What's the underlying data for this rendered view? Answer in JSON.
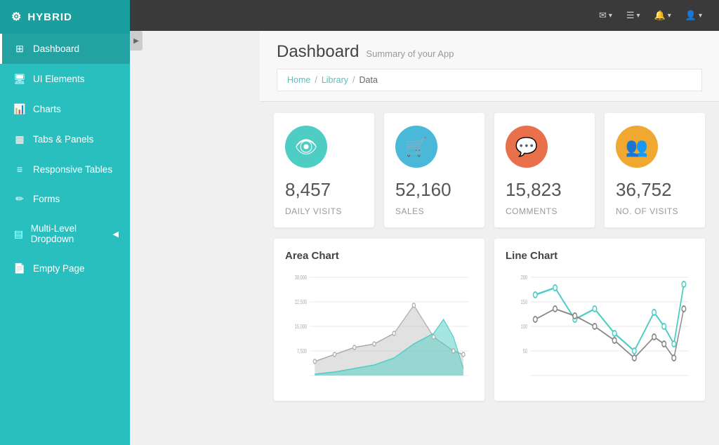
{
  "app": {
    "name": "HYBRID"
  },
  "topbar": {
    "mail_label": "✉",
    "menu_label": "☰",
    "bell_label": "🔔",
    "user_label": "👤"
  },
  "sidebar": {
    "items": [
      {
        "id": "dashboard",
        "label": "Dashboard",
        "icon": "⊞",
        "active": true
      },
      {
        "id": "ui-elements",
        "label": "UI Elements",
        "icon": "🖥"
      },
      {
        "id": "charts",
        "label": "Charts",
        "icon": "📊"
      },
      {
        "id": "tabs-panels",
        "label": "Tabs & Panels",
        "icon": "▦"
      },
      {
        "id": "responsive-tables",
        "label": "Responsive Tables",
        "icon": "≡"
      },
      {
        "id": "forms",
        "label": "Forms",
        "icon": "✏"
      },
      {
        "id": "multi-level-dropdown",
        "label": "Multi-Level Dropdown",
        "icon": "▤",
        "has_arrow": true
      },
      {
        "id": "empty-page",
        "label": "Empty Page",
        "icon": "📄"
      }
    ]
  },
  "breadcrumb": {
    "items": [
      "Home",
      "Library",
      "Data"
    ]
  },
  "page": {
    "title": "Dashboard",
    "subtitle": "Summary of your App"
  },
  "stats": [
    {
      "id": "daily-visits",
      "value": "8,457",
      "label": "Daily Visits",
      "icon": "👁",
      "color": "#4ecdc4"
    },
    {
      "id": "sales",
      "value": "52,160",
      "label": "Sales",
      "icon": "🛒",
      "color": "#4ab8d8"
    },
    {
      "id": "comments",
      "value": "15,823",
      "label": "Comments",
      "icon": "💬",
      "color": "#e8704a"
    },
    {
      "id": "no-visits",
      "value": "36,752",
      "label": "No. of Visits",
      "icon": "👥",
      "color": "#f0a830"
    }
  ],
  "charts": {
    "area": {
      "title": "Area Chart",
      "y_labels": [
        "30,000",
        "22,500",
        "15,000",
        "7,500"
      ],
      "color1": "#aaaaaa",
      "color2": "#4ecdc4"
    },
    "line": {
      "title": "Line Chart",
      "y_labels": [
        "200",
        "150",
        "100",
        "50"
      ],
      "color1": "#4ecdc4",
      "color2": "#888888"
    }
  }
}
